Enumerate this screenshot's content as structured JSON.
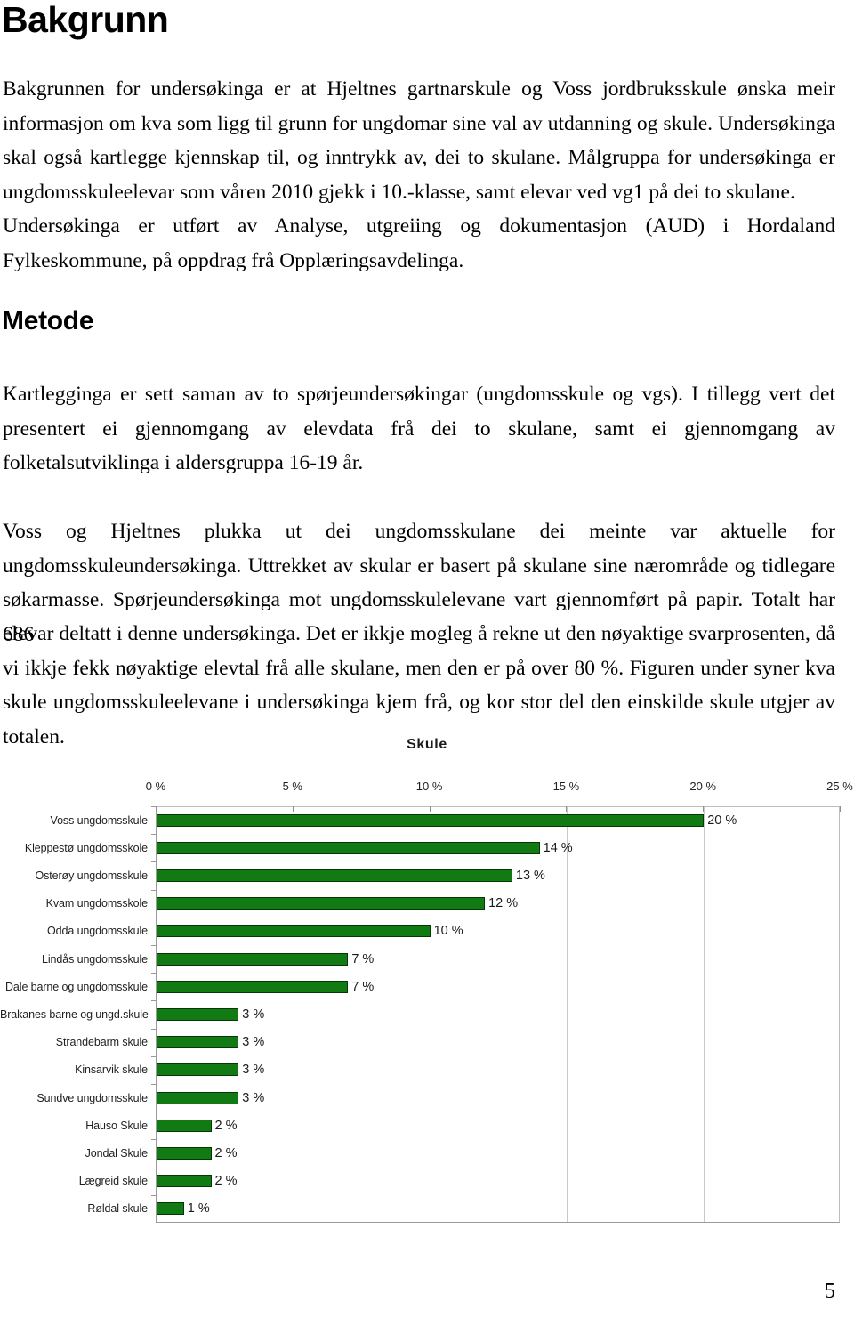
{
  "document": {
    "heading_1": "Bakgrunn",
    "heading_2": "Metode",
    "page_number": "5",
    "paragraphs": {
      "p1": "Bakgrunnen for undersøkinga er at Hjeltnes gartnarskule og Voss jordbruksskule ønska meir informasjon om kva som ligg til grunn for ungdomar sine val av utdanning og skule. Undersøkinga skal  også kartlegge kjennskap til, og inntrykk av, dei to skulane. Målgruppa for undersøkinga er ungdomsskuleelevar som våren 2010 gjekk i 10.-klasse, samt elevar ved vg1 på dei to skulane.",
      "p2": "Undersøkinga er utført av Analyse, utgreiing og dokumentasjon (AUD) i Hordaland Fylkeskommune, på oppdrag frå Opplæringsavdelinga.",
      "p3": "Kartlegginga er sett saman av to spørjeundersøkingar (ungdomsskule og vgs). I tillegg vert det presentert ei gjennomgang av elevdata frå dei to skulane, samt ei gjennomgang av  folketalsutviklinga i aldersgruppa 16-19 år.",
      "p4": "Voss og Hjeltnes plukka ut dei ungdomsskulane dei meinte var aktuelle for ungdomsskuleundersøkinga. Uttrekket av skular er basert på skulane sine nærområde og tidlegare søkarmasse. Spørjeundersøkinga mot ungdomsskulelevane vart gjennomført på papir. Totalt har 686",
      "p5": "elevar deltatt i denne undersøkinga. Det er ikkje mogleg å rekne ut den nøyaktige svarprosenten, då vi ikkje fekk nøyaktige elevtal frå alle skulane, men den er på over 80 %. Figuren under syner kva skule ungdomsskuleelevane i undersøkinga kjem frå, og kor stor del den einskilde skule utgjer av totalen."
    }
  },
  "chart_data": {
    "type": "bar",
    "orientation": "horizontal",
    "title": "Skule",
    "xlabel": "",
    "ylabel": "",
    "xlim": [
      0,
      25
    ],
    "xtick_labels": [
      "0 %",
      "5 %",
      "10 %",
      "15 %",
      "20 %",
      "25 %"
    ],
    "xtick_values": [
      0,
      5,
      10,
      15,
      20,
      25
    ],
    "grid": true,
    "legend": false,
    "bar_color": "#127a12",
    "bar_border_color": "#063806",
    "categories": [
      "Voss ungdomsskule",
      "Kleppestø ungdomsskole",
      "Osterøy ungdomsskule",
      "Kvam ungdomsskole",
      "Odda ungdomsskule",
      "Lindås ungdomsskule",
      "Dale barne og ungdomsskule",
      "Brakanes barne og ungd.skule",
      "Strandebarm skule",
      "Kinsarvik skule",
      "Sundve ungdomsskule",
      "Hauso Skule",
      "Jondal Skule",
      "Lægreid skule",
      "Røldal skule"
    ],
    "values": [
      20,
      14,
      13,
      12,
      10,
      7,
      7,
      3,
      3,
      3,
      3,
      2,
      2,
      2,
      1
    ],
    "data_labels": [
      "20 %",
      "14 %",
      "13 %",
      "12 %",
      "10 %",
      "7 %",
      "7 %",
      "3 %",
      "3 %",
      "3 %",
      "3 %",
      "2 %",
      "2 %",
      "2 %",
      "1 %"
    ]
  }
}
